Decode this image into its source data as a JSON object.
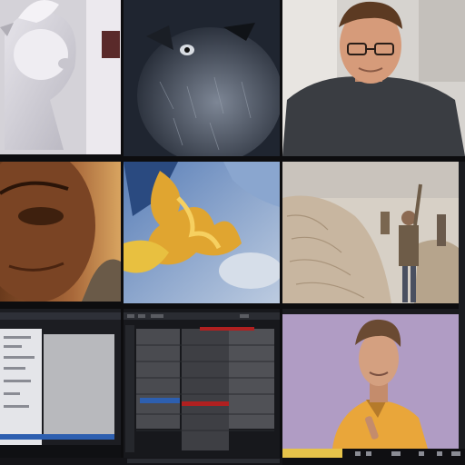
{
  "grid": {
    "rows": 3,
    "columns": 3,
    "tiles": [
      {
        "icon": "white-rabbit-figurine-thumbnail"
      },
      {
        "icon": "furry-animal-thumbnail"
      },
      {
        "icon": "man-with-glasses-thumbnail"
      },
      {
        "icon": "face-closeup-thumbnail"
      },
      {
        "icon": "fire-and-sky-thumbnail"
      },
      {
        "icon": "sand-dunes-people-thumbnail"
      },
      {
        "icon": "software-window-thumbnail"
      },
      {
        "icon": "video-editor-timeline-thumbnail"
      },
      {
        "icon": "man-yellow-shirt-thumbnail"
      }
    ]
  },
  "colors": {
    "background": "#0d0d0f",
    "editor_red": "#b02020",
    "editor_blue": "#2d5fb0",
    "backdrop_lilac": "#b09cc4",
    "shirt_yellow": "#e9a63a"
  }
}
